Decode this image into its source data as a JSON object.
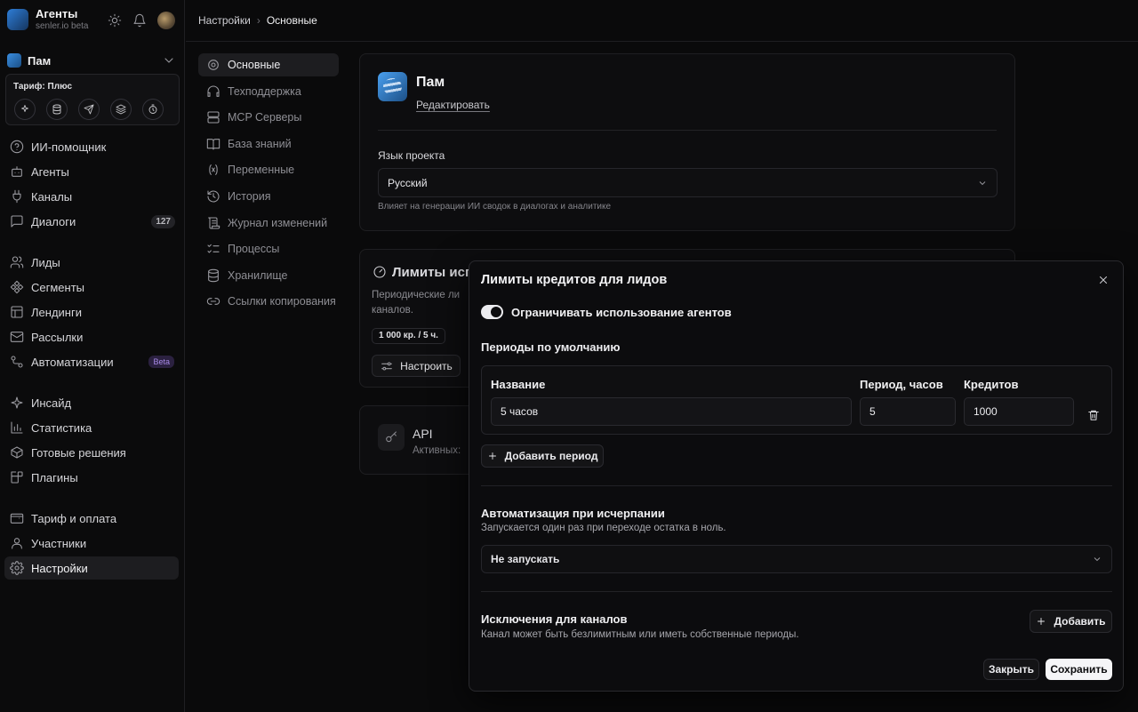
{
  "brand": {
    "title": "Агенты",
    "subtitle": "senler.io beta"
  },
  "project": {
    "name": "Пам"
  },
  "plan": {
    "label": "Тариф: Плюс"
  },
  "nav": {
    "items": [
      {
        "label": "ИИ-помощник",
        "icon": "help-circle-icon"
      },
      {
        "label": "Агенты",
        "icon": "bot-icon"
      },
      {
        "label": "Каналы",
        "icon": "plug-icon"
      },
      {
        "label": "Диалоги",
        "icon": "chat-icon",
        "badge": "127"
      },
      {
        "label": "Лиды",
        "icon": "users-icon"
      },
      {
        "label": "Сегменты",
        "icon": "segments-icon"
      },
      {
        "label": "Лендинги",
        "icon": "layout-icon"
      },
      {
        "label": "Рассылки",
        "icon": "mail-icon"
      },
      {
        "label": "Автоматизации",
        "icon": "workflow-icon",
        "badge": "Beta"
      },
      {
        "label": "Инсайд",
        "icon": "sparkle-icon"
      },
      {
        "label": "Статистика",
        "icon": "chart-icon"
      },
      {
        "label": "Готовые решения",
        "icon": "package-icon"
      },
      {
        "label": "Плагины",
        "icon": "puzzle-icon"
      },
      {
        "label": "Тариф и оплата",
        "icon": "wallet-icon"
      },
      {
        "label": "Участники",
        "icon": "user-icon"
      },
      {
        "label": "Настройки",
        "icon": "gear-icon"
      }
    ]
  },
  "breadcrumb": {
    "parent": "Настройки",
    "current": "Основные"
  },
  "settings_nav": [
    "Основные",
    "Техподдержка",
    "MCP Серверы",
    "База знаний",
    "Переменные",
    "История",
    "Журнал изменений",
    "Процессы",
    "Хранилище",
    "Ссылки копирования"
  ],
  "project_card": {
    "name": "Пам",
    "edit": "Редактировать",
    "lang_label": "Язык проекта",
    "lang_value": "Русский",
    "lang_help": "Влияет на генерации ИИ сводок в диалогах и аналитике"
  },
  "limits_card": {
    "title": "Лимиты исп",
    "desc": "Периодические ли каналов.",
    "chip": "1 000 кр. / 5 ч.",
    "configure": "Настроить"
  },
  "api_card": {
    "title": "API",
    "sub": "Активных:"
  },
  "modal": {
    "title": "Лимиты кредитов для лидов",
    "toggle_label": "Ограничивать использование агентов",
    "toggle_on": true,
    "periods_title": "Периоды по умолчанию",
    "col_name": "Название",
    "col_period": "Период, часов",
    "col_credits": "Кредитов",
    "row": {
      "name": "5 часов",
      "period": "5",
      "credits": "1000"
    },
    "add_period": "Добавить период",
    "auto_title": "Автоматизация при исчерпании",
    "auto_desc": "Запускается один раз при переходе остатка в ноль.",
    "auto_value": "Не запускать",
    "exc_title": "Исключения для каналов",
    "exc_desc": "Канал может быть безлимитным или иметь собственные периоды.",
    "exc_add": "Добавить",
    "close": "Закрыть",
    "save": "Сохранить"
  }
}
